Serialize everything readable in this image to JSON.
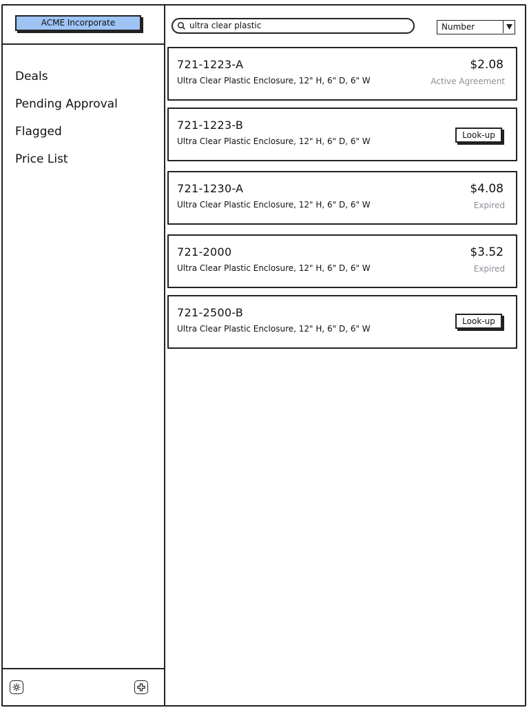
{
  "sidebar": {
    "brand_label": "ACME Incorporate",
    "nav": [
      {
        "label": "Deals"
      },
      {
        "label": "Pending Approval"
      },
      {
        "label": "Flagged"
      },
      {
        "label": "Price List"
      }
    ],
    "footer_icons": [
      "settings-icon",
      "add-icon"
    ]
  },
  "search": {
    "value": "ultra clear plastic",
    "icon": "search-icon"
  },
  "sort_select": {
    "value": "Number",
    "icon": "triangle-down-icon"
  },
  "results": [
    {
      "part_number": "721-1223-A",
      "description": "Ultra Clear Plastic Enclosure, 12\" H, 6\" D, 6\" W",
      "price": "$2.08",
      "status": "Active Agreement"
    },
    {
      "part_number": "721-1223-B",
      "description": "Ultra Clear Plastic Enclosure, 12\" H, 6\" D, 6\" W",
      "action_label": "Look-up"
    },
    {
      "part_number": "721-1230-A",
      "description": "Ultra Clear Plastic Enclosure, 12\" H, 6\" D, 6\" W",
      "price": "$4.08",
      "status": "Expired"
    },
    {
      "part_number": "721-2000",
      "description": "Ultra Clear Plastic Enclosure, 12\" H, 6\" D, 6\" W",
      "price": "$3.52",
      "status": "Expired"
    },
    {
      "part_number": "721-2500-B",
      "description": "Ultra Clear Plastic Enclosure, 12\" H, 6\" D, 6\" W",
      "action_label": "Look-up"
    }
  ],
  "colors": {
    "brand_button": "#9ec4f5",
    "status_text": "#8a8f96",
    "outline": "#222222"
  }
}
